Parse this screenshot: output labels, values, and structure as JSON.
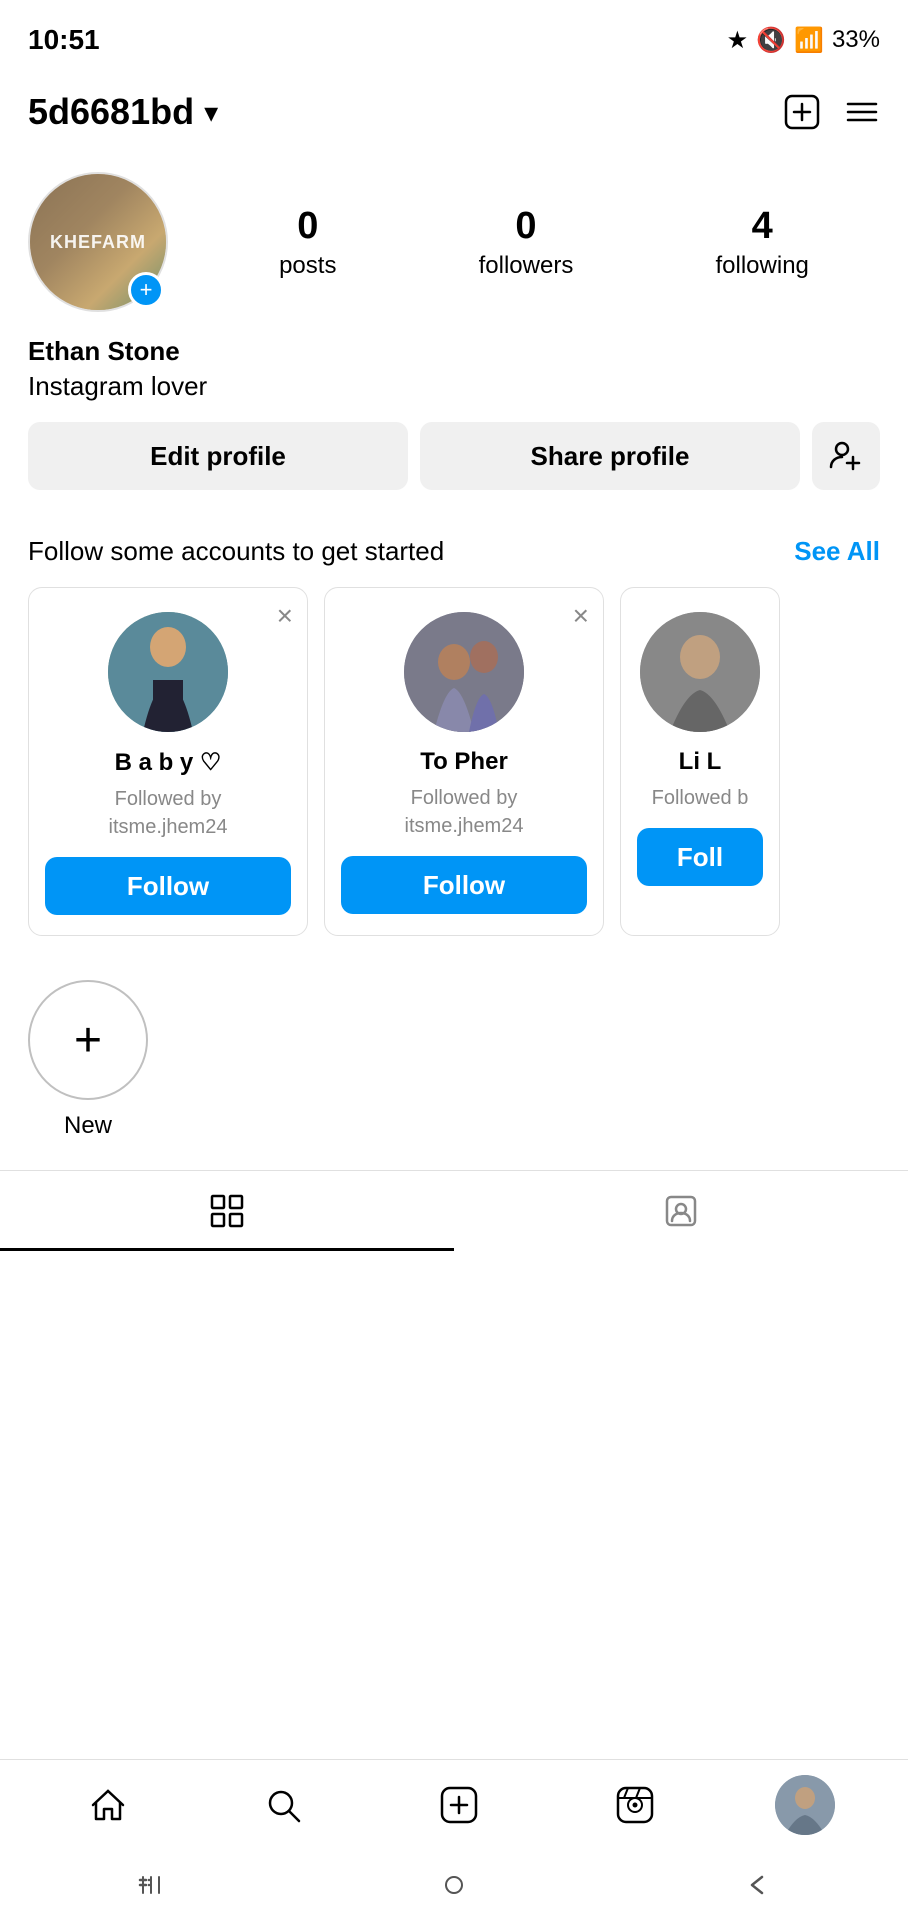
{
  "status_bar": {
    "time": "10:51",
    "battery": "33%"
  },
  "header": {
    "username": "5d6681bd",
    "chevron": "▾",
    "add_icon": "⊞",
    "menu_icon": "≡"
  },
  "profile": {
    "name": "Ethan Stone",
    "bio": "Instagram lover",
    "posts_count": "0",
    "posts_label": "posts",
    "followers_count": "0",
    "followers_label": "followers",
    "following_count": "4",
    "following_label": "following",
    "edit_label": "Edit profile",
    "share_label": "Share profile"
  },
  "follow_section": {
    "title": "Follow some accounts to get started",
    "see_all": "See All",
    "suggestions": [
      {
        "name": "B a b y ♡",
        "followed_by": "Followed by\nitsme.jhem24",
        "follow_label": "Follow"
      },
      {
        "name": "To Pher",
        "followed_by": "Followed by\nitsme.jhem24",
        "follow_label": "Follow"
      },
      {
        "name": "Li L",
        "followed_by": "Followed b",
        "follow_label": "Foll"
      }
    ]
  },
  "new_story": {
    "label": "New",
    "plus_icon": "+"
  },
  "tabs": {
    "grid_tab": "grid",
    "tagged_tab": "tagged"
  },
  "bottom_nav": {
    "home": "home",
    "search": "search",
    "add": "add",
    "reels": "reels",
    "profile": "profile"
  },
  "android_nav": {
    "menu": "|||",
    "home": "○",
    "back": "<"
  }
}
